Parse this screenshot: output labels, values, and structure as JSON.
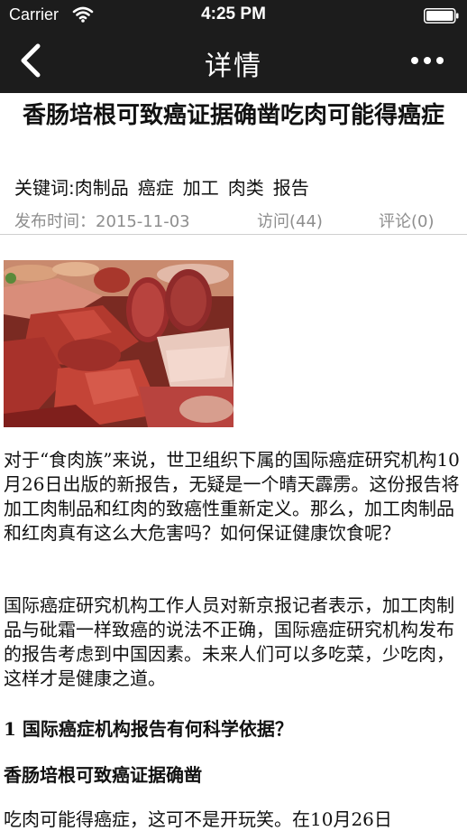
{
  "status_bar": {
    "carrier": "Carrier",
    "time": "4:25 PM",
    "icons": [
      "wifi-icon",
      "battery-icon"
    ]
  },
  "nav": {
    "title": "详情",
    "back_icon": "chevron-left-icon",
    "more_icon": "more-dots-icon"
  },
  "article": {
    "title": "香肠培根可致癌证据确凿吃肉可能得癌症",
    "keywords_label": "关键词:",
    "keywords": [
      "肉制品",
      "癌症",
      "加工",
      "肉类",
      "报告"
    ],
    "publish_time": "发布时间：2015-11-03",
    "visits": "访问(44)",
    "comments": "评论(0)",
    "paragraph1": "对于“食肉族”来说，世卫组织下属的国际癌症研究机构10月26日出版的新报告，无疑是一个晴天霹雳。这份报告将加工肉制品和红肉的致癌性重新定义。那么，加工肉制品和红肉真有这么大危害吗？如何保证健康饮食呢？",
    "paragraph2": "国际癌症研究机构工作人员对新京报记者表示，加工肉制品与砒霜一样致癌的说法不正确，国际癌症研究机构发布的报告考虑到中国因素。未来人们可以多吃菜，少吃肉，这样才是健康之道。",
    "heading1": "1 国际癌症机构报告有何科学依据？",
    "heading2": "香肠培根可致癌证据确凿",
    "paragraph3": "吃肉可能得癌症，这可不是开玩笑。在10月26日"
  },
  "colors": {
    "nav_background": "#1c1c1c",
    "meta_text": "#8e8e8e",
    "divider": "#cfcfcf"
  }
}
